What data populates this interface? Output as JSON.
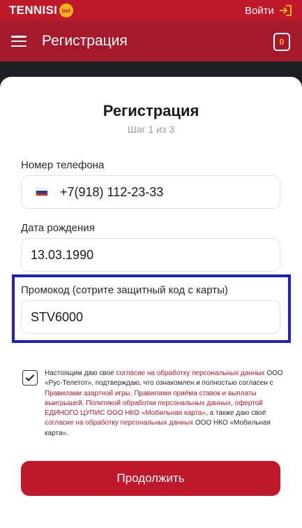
{
  "topbar": {
    "brand": "TENNISI",
    "brand_badge": "bet",
    "login_label": "Войти",
    "login_icon": "login-arrow-icon"
  },
  "header": {
    "menu_icon": "hamburger-icon",
    "title": "Регистрация",
    "coupon_icon": "coupon-icon",
    "coupon_count": "0"
  },
  "form": {
    "title": "Регистрация",
    "step": "Шаг 1 из 3",
    "phone": {
      "label": "Номер телефона",
      "value": "+7(918) 112-23-33",
      "flag_icon": "russia-flag-icon"
    },
    "birthdate": {
      "label": "Дата рождения",
      "value": "13.03.1990"
    },
    "promo": {
      "label": "Промокод (сотрите защитный код с карты)",
      "value": "STV6000"
    },
    "consent": {
      "checked": true,
      "p1": "Настоящим даю свое ",
      "l1": "согласие на обработку персональных данных",
      "p2": " ООО «Рус-Телетот», подтверждаю, что ознакомлен и полностью согласен с ",
      "l2": "Правилами азартной игры, Правилами приёма ставок и выплаты выигрышей, Политикой обработки персональных данных, офертой ЕДИНОГО ЦУПИС ООО НКО «Мобильная карта»",
      "p3": ", а также даю своё ",
      "l3": "согласие на обработку персональных данных",
      "p4": " ООО НКО «Мобильная карта»."
    },
    "submit_label": "Продолжить"
  },
  "colors": {
    "brand_red": "#c0182b",
    "header_red": "#a5192c",
    "accent_yellow": "#f3b41d",
    "highlight_blue": "#1f1dcc"
  }
}
